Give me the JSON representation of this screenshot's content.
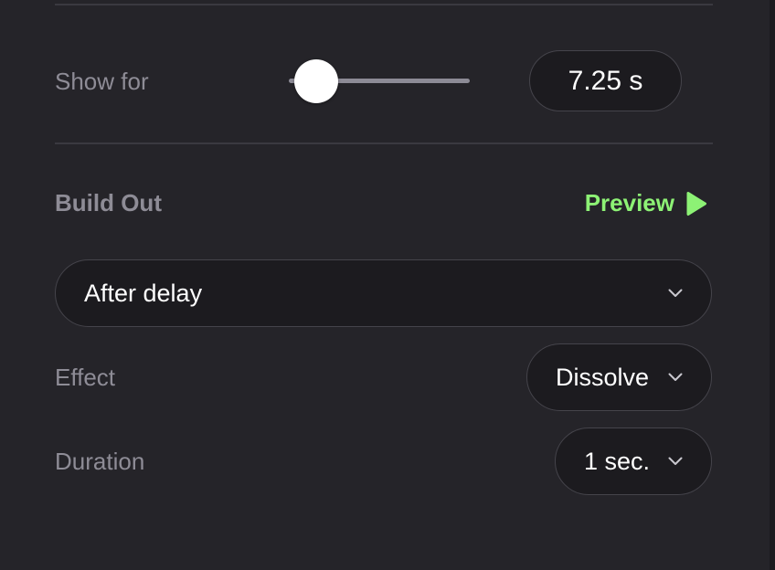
{
  "show_for": {
    "label": "Show for",
    "slider_level": 0.04,
    "value": "7.25 s"
  },
  "build_out": {
    "title": "Build Out",
    "preview_label": "Preview",
    "preview_icon": "play-icon",
    "trigger": {
      "selected": "After delay",
      "icon": "chevron-down-icon"
    },
    "effect": {
      "label": "Effect",
      "selected": "Dissolve",
      "icon": "chevron-down-icon"
    },
    "duration": {
      "label": "Duration",
      "selected": "1 sec.",
      "icon": "chevron-down-icon"
    }
  },
  "colors": {
    "background": "#252429",
    "accent": "#8df275",
    "label": "#8e8c96",
    "field": "#1c1b1f"
  }
}
